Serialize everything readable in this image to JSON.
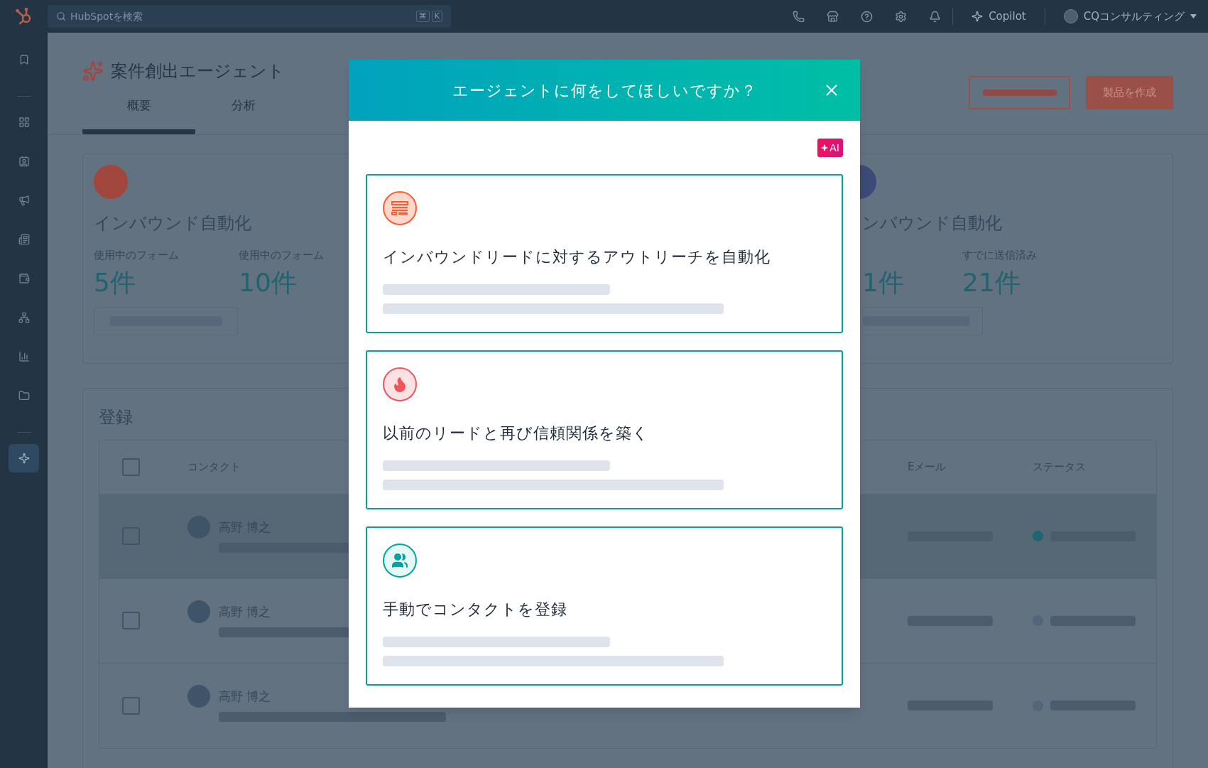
{
  "top_bar": {
    "search": {
      "placeholder": "HubSpotを検索",
      "keys": [
        "⌘",
        "K"
      ]
    },
    "copilot": "Copilot",
    "account": "CQコンサルティング"
  },
  "sidebar": {
    "items": [
      {
        "kind": "bookmark",
        "selected": false
      },
      {
        "kind": "grid",
        "selected": false
      },
      {
        "kind": "contacts",
        "selected": false
      },
      {
        "kind": "megaphone",
        "selected": false
      },
      {
        "kind": "document",
        "selected": false
      },
      {
        "kind": "wallet",
        "selected": false
      },
      {
        "kind": "network",
        "selected": false
      },
      {
        "kind": "chart",
        "selected": false
      },
      {
        "kind": "folder",
        "selected": false
      },
      {
        "kind": "sparkle",
        "selected": true
      }
    ]
  },
  "page": {
    "title": "案件創出エージェント",
    "tabs": [
      {
        "label": "概要",
        "selected": true
      },
      {
        "label": "分析",
        "selected": false
      }
    ],
    "create_button": "製品を作成"
  },
  "summary_cards": [
    {
      "color": "#a1463c",
      "title": "インバウンド自動化",
      "stats": [
        {
          "label": "使用中のフォーム",
          "value": "5件"
        },
        {
          "label": "使用中のフォーム",
          "value": "10件"
        }
      ]
    },
    {
      "color": "#3c4a78",
      "title": "ンバウンド自動化",
      "stats": [
        {
          "value": "1件"
        },
        {
          "label": "すでに送信済み",
          "value": "21件"
        }
      ]
    }
  ],
  "enrollment": {
    "title": "登録",
    "select_all_checked": false,
    "columns": [
      {
        "label": "コンタクト"
      },
      {
        "label": "Eメール"
      },
      {
        "label": "ステータス"
      }
    ],
    "rows": [
      {
        "name": "高野 博之",
        "highlighted": true,
        "checked": false,
        "color": "#1e6670"
      },
      {
        "name": "高野 博之",
        "highlighted": false,
        "checked": false,
        "color": "#53657a"
      },
      {
        "name": "高野 博之",
        "highlighted": false,
        "checked": false,
        "color": "#53657a"
      }
    ]
  },
  "modal": {
    "title": "エージェントに何をしてほしいですか？",
    "badge": "AI",
    "options": [
      {
        "kind": "form",
        "title": "インバウンドリードに対するアウトリーチを自動化"
      },
      {
        "kind": "fire",
        "title": "以前のリードと再び信頼関係を築く"
      },
      {
        "kind": "people",
        "title": "手動でコンタクトを登録"
      }
    ]
  }
}
